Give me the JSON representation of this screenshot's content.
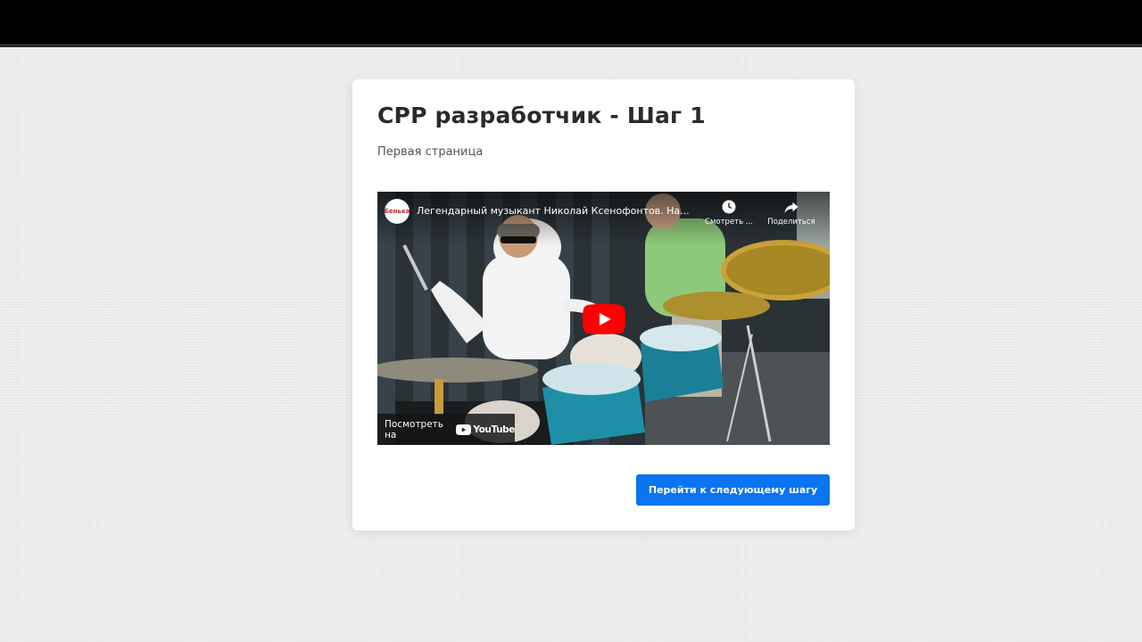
{
  "page": {
    "title": "CPP разработчик - Шаг 1",
    "subtitle": "Первая страница"
  },
  "video": {
    "title": "Легендарный музыкант Николай Ксенофонтов. На...",
    "channel_avatar_text": "Бенька",
    "watch_later_label": "Смотреть ...",
    "share_label": "Поделиться",
    "watch_on_label": "Посмотреть на",
    "youtube_logo_text": "YouTube",
    "icons": [
      "clock-icon",
      "share-icon",
      "play-icon",
      "youtube-logo-icon"
    ]
  },
  "actions": {
    "next_step_label": "Перейти к следующему шагу"
  },
  "colors": {
    "accent": "#0a74f1",
    "youtube_red": "#ff0000",
    "top_bar": "#000000"
  }
}
